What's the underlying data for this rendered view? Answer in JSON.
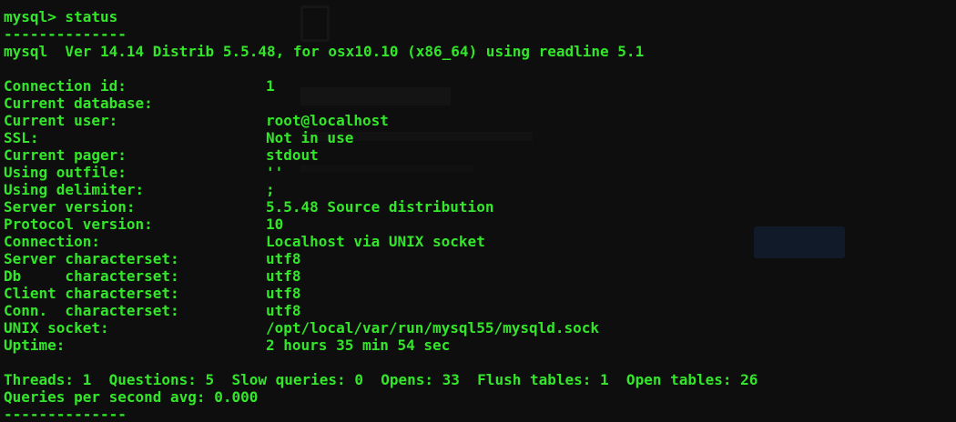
{
  "prompt": "mysql> status",
  "separator": "--------------",
  "version_line": "mysql  Ver 14.14 Distrib 5.5.48, for osx10.10 (x86_64) using readline 5.1",
  "status": [
    {
      "key": "Connection id:",
      "value": "1"
    },
    {
      "key": "Current database:",
      "value": ""
    },
    {
      "key": "Current user:",
      "value": "root@localhost"
    },
    {
      "key": "SSL:",
      "value": "Not in use"
    },
    {
      "key": "Current pager:",
      "value": "stdout"
    },
    {
      "key": "Using outfile:",
      "value": "''"
    },
    {
      "key": "Using delimiter:",
      "value": ";"
    },
    {
      "key": "Server version:",
      "value": "5.5.48 Source distribution"
    },
    {
      "key": "Protocol version:",
      "value": "10"
    },
    {
      "key": "Connection:",
      "value": "Localhost via UNIX socket"
    },
    {
      "key": "Server characterset:",
      "value": "utf8"
    },
    {
      "key": "Db     characterset:",
      "value": "utf8"
    },
    {
      "key": "Client characterset:",
      "value": "utf8"
    },
    {
      "key": "Conn.  characterset:",
      "value": "utf8"
    },
    {
      "key": "UNIX socket:",
      "value": "/opt/local/var/run/mysql55/mysqld.sock"
    },
    {
      "key": "Uptime:",
      "value": "2 hours 35 min 54 sec"
    }
  ],
  "threads_line": "Threads: 1  Questions: 5  Slow queries: 0  Opens: 33  Flush tables: 1  Open tables: 26",
  "qps_line": "Queries per second avg: 0.000",
  "colors": {
    "text": "#33e62a",
    "background": "#0e0e0e"
  }
}
